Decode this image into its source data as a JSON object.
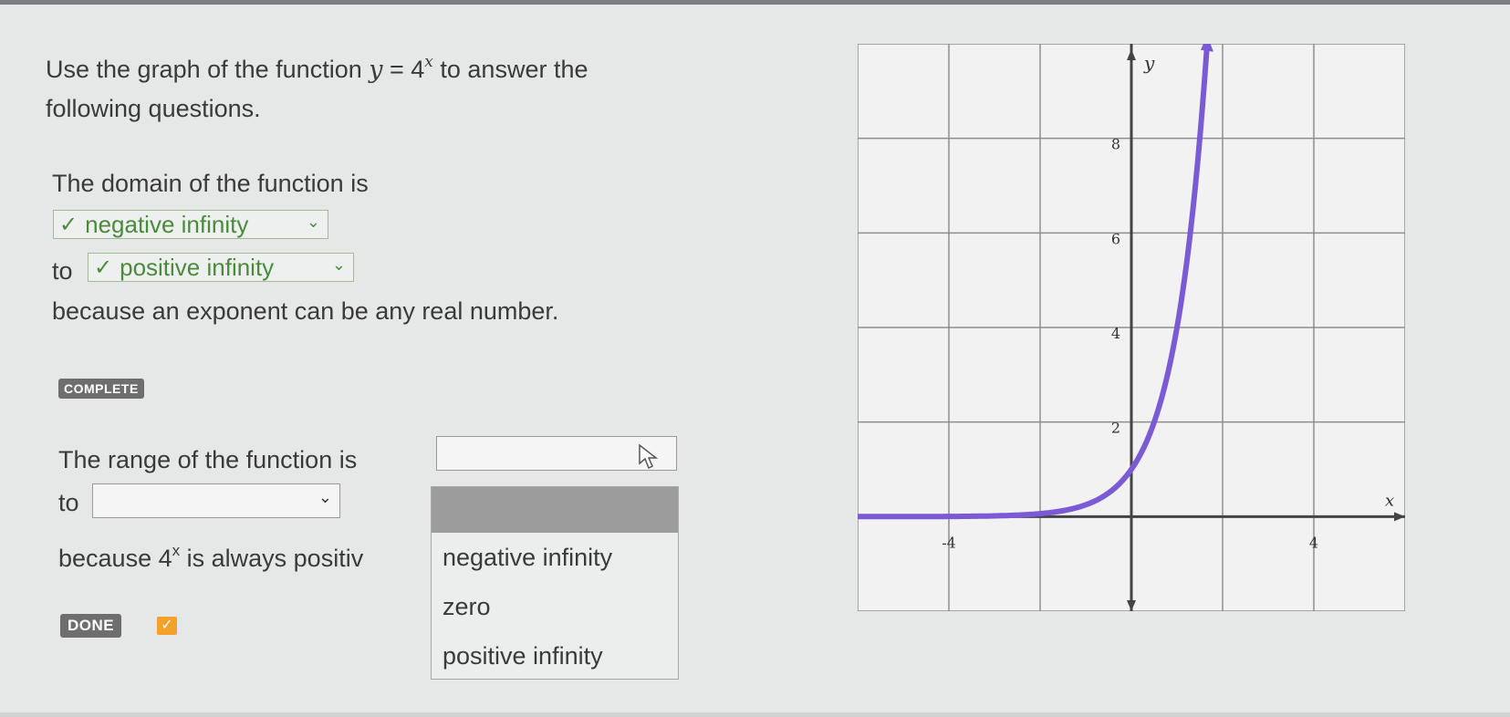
{
  "question": {
    "intro_part1": "Use the graph of the function ",
    "function_lhs": "y",
    "function_eq": " = 4",
    "function_exp": "x",
    "intro_part2": " to answer the",
    "intro_line2": "following questions."
  },
  "domain": {
    "prompt": "The domain of the function is",
    "from_value": "negative infinity",
    "to_label": "to",
    "to_value": "positive infinity",
    "reason": "because an exponent can be any real number.",
    "status_badge": "COMPLETE"
  },
  "range": {
    "prompt": "The range of the function is",
    "from_value": "",
    "to_label": "to",
    "to_value": "",
    "reason_part1": "because ",
    "reason_base": "4",
    "reason_exp": "x",
    "reason_part2": " is always positiv",
    "done_label": "DONE",
    "dropdown_options": [
      "negative infinity",
      "zero",
      "positive infinity"
    ]
  },
  "icons": {
    "check": "check-icon",
    "chevron": "chevron-down-icon",
    "cursor": "mouse-pointer-icon"
  },
  "colors": {
    "correct": "#4b8a3c",
    "curve": "#7b5ad6",
    "done_check": "#f2a22a"
  },
  "chart_data": {
    "type": "line",
    "function": "y = 4^x",
    "xlabel": "x",
    "ylabel": "y",
    "xlim": [
      -6,
      6
    ],
    "ylim": [
      -2,
      10
    ],
    "grid": true,
    "x_ticks": [
      -4,
      4
    ],
    "y_ticks": [
      2,
      4,
      6,
      8
    ],
    "x_tick_labels": [
      "-4",
      "4"
    ],
    "y_tick_labels": [
      "2",
      "4",
      "6",
      "8"
    ],
    "series": [
      {
        "points": [
          [
            -8,
            0
          ],
          [
            -4,
            0.0039
          ],
          [
            -3,
            0.0156
          ],
          [
            -2,
            0.0625
          ],
          [
            -1.5,
            0.125
          ],
          [
            -1,
            0.25
          ],
          [
            -0.5,
            0.5
          ],
          [
            0,
            1
          ],
          [
            0.25,
            1.41
          ],
          [
            0.5,
            2
          ],
          [
            0.75,
            2.83
          ],
          [
            1,
            4
          ],
          [
            1.25,
            5.66
          ],
          [
            1.5,
            8
          ],
          [
            1.65,
            9.85
          ]
        ]
      }
    ]
  }
}
